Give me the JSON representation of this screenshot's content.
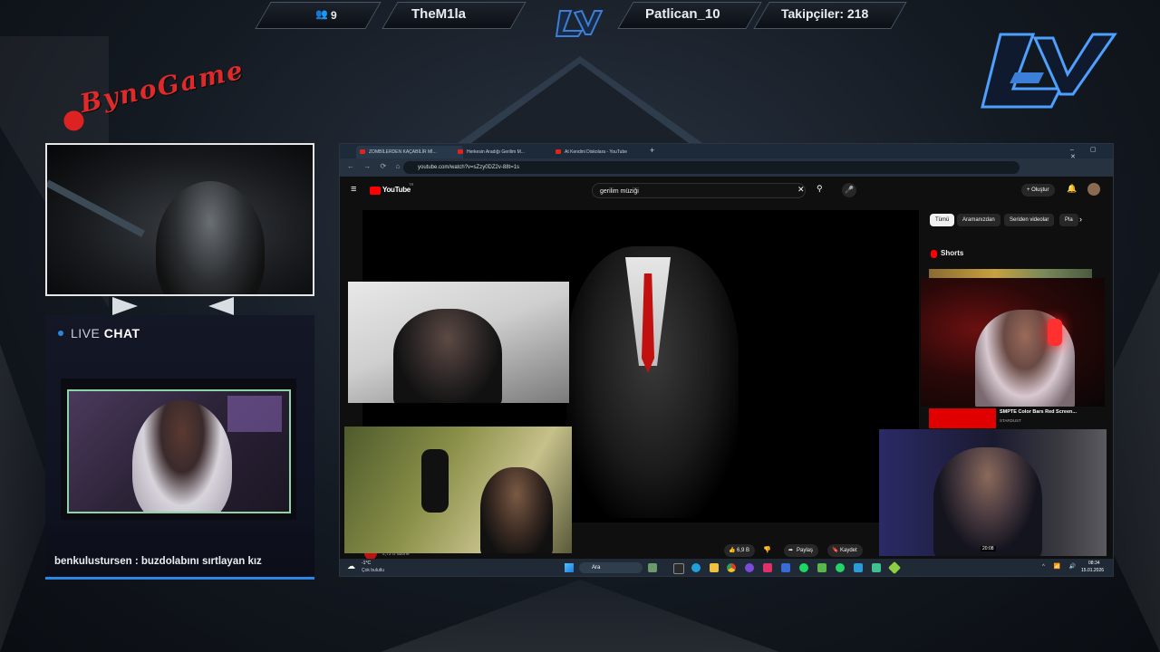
{
  "overlay": {
    "viewer_count": "9",
    "streamer_left": "TheM1la",
    "streamer_right": "Patlican_10",
    "followers": "Takipçiler: 218",
    "brand_text": "BynoGame",
    "accent_color": "#2a86e0"
  },
  "chat": {
    "title_live": "LIVE",
    "title_chat": "CHAT",
    "last_message_user": "benkulustursen",
    "last_message_sep": " : ",
    "last_message_text": "buzdolabını sırtlayan kız"
  },
  "browser": {
    "tabs": [
      {
        "label": "ZOMBİLERDEN KAÇABİLİR Mİ..."
      },
      {
        "label": "Herkesin Aradığı Gerilim M..."
      },
      {
        "label": "At Kendini Diskolara - YouTube"
      }
    ],
    "url": "youtube.com/watch?v=sZzy0DZ2v-88t=1s"
  },
  "youtube": {
    "logo": "YouTube",
    "logo_region": "TR",
    "search_value": "gerilim müziği",
    "create_label": "Oluştur",
    "chips": [
      "Tümü",
      "Aramanızdan",
      "Seriden videolar",
      "Pla"
    ],
    "shorts_label": "Shorts",
    "subscribers": "2,72 B abone",
    "like_count": "6,9 B",
    "share_label": "Paylaş",
    "save_label": "Kaydet",
    "related_title": "SMPTE Color Bars Red Screen...",
    "related_channel": "STARDUST",
    "related_duration": "20:08"
  },
  "taskbar": {
    "weather_temp": "-1°C",
    "weather_desc": "Çok bulutlu",
    "search_label": "Ara",
    "time": "08:34",
    "date": "15.01.2026"
  }
}
